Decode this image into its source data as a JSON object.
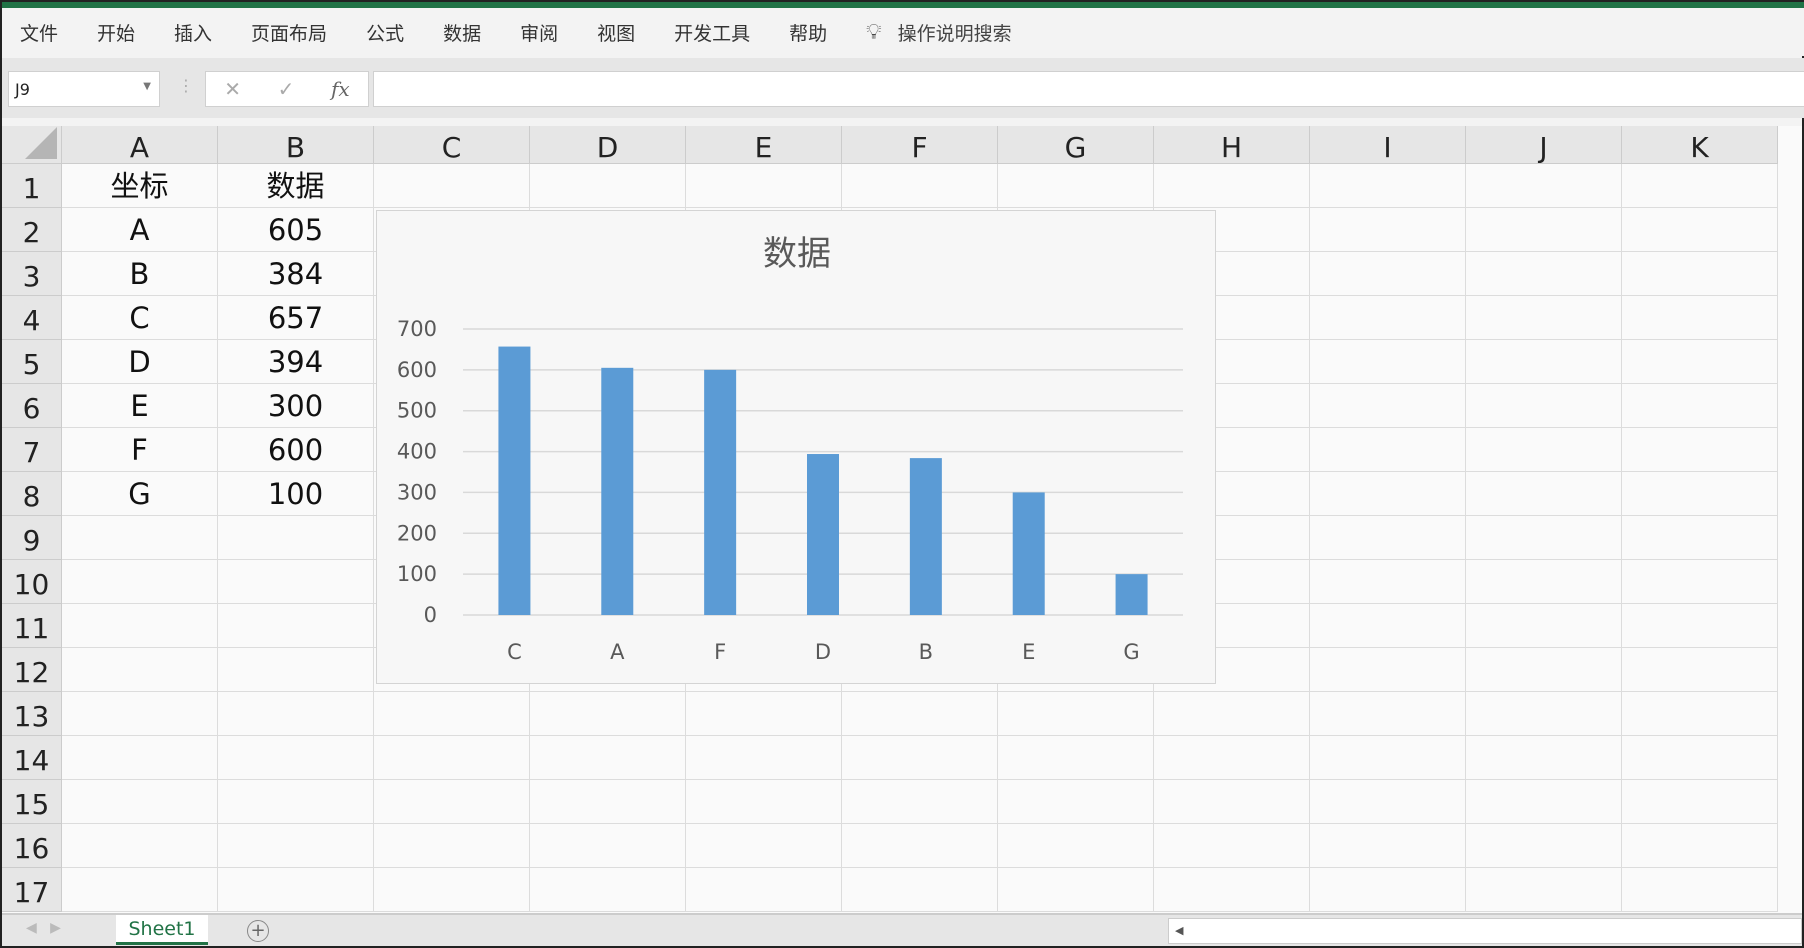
{
  "ribbon": {
    "tabs": [
      "文件",
      "开始",
      "插入",
      "页面布局",
      "公式",
      "数据",
      "审阅",
      "视图",
      "开发工具",
      "帮助"
    ],
    "search": "操作说明搜索"
  },
  "formula_bar": {
    "name_box": "J9",
    "cancel": "✕",
    "enter": "✓",
    "fx": "fx",
    "value": ""
  },
  "columns": [
    "A",
    "B",
    "C",
    "D",
    "E",
    "F",
    "G",
    "H",
    "I",
    "J",
    "K"
  ],
  "rows": [
    "1",
    "2",
    "3",
    "4",
    "5",
    "6",
    "7",
    "8",
    "9",
    "10",
    "11",
    "12",
    "13",
    "14",
    "15",
    "16",
    "17"
  ],
  "cells": [
    [
      "坐标",
      "数据"
    ],
    [
      "A",
      "605"
    ],
    [
      "B",
      "384"
    ],
    [
      "C",
      "657"
    ],
    [
      "D",
      "394"
    ],
    [
      "E",
      "300"
    ],
    [
      "F",
      "600"
    ],
    [
      "G",
      "100"
    ]
  ],
  "sheet_tabs": {
    "active": "Sheet1",
    "add": "+"
  },
  "chart_data": {
    "type": "bar",
    "title": "数据",
    "categories": [
      "C",
      "A",
      "F",
      "D",
      "B",
      "E",
      "G"
    ],
    "values": [
      657,
      605,
      600,
      394,
      384,
      300,
      100
    ],
    "ylim": [
      0,
      700
    ],
    "yticks": [
      "0",
      "100",
      "200",
      "300",
      "400",
      "500",
      "600",
      "700"
    ],
    "grid": true,
    "color": "#5b9bd5"
  }
}
